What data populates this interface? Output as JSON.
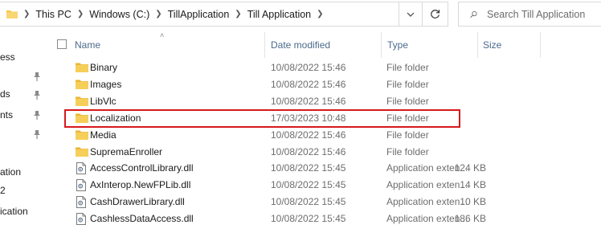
{
  "address_bar": {
    "crumbs": [
      "This PC",
      "Windows (C:)",
      "TillApplication",
      "Till Application"
    ]
  },
  "search": {
    "placeholder": "Search Till Application"
  },
  "nav_pane": {
    "items": [
      "ess",
      "ds",
      "nts",
      "ation",
      "2",
      "ication"
    ]
  },
  "columns": {
    "name": "Name",
    "date_modified": "Date modified",
    "type": "Type",
    "size": "Size"
  },
  "files": [
    {
      "name": "Binary",
      "date": "10/08/2022 15:46",
      "type": "File folder",
      "size": "",
      "kind": "folder"
    },
    {
      "name": "Images",
      "date": "10/08/2022 15:46",
      "type": "File folder",
      "size": "",
      "kind": "folder"
    },
    {
      "name": "LibVlc",
      "date": "10/08/2022 15:46",
      "type": "File folder",
      "size": "",
      "kind": "folder"
    },
    {
      "name": "Localization",
      "date": "17/03/2023 10:48",
      "type": "File folder",
      "size": "",
      "kind": "folder"
    },
    {
      "name": "Media",
      "date": "10/08/2022 15:46",
      "type": "File folder",
      "size": "",
      "kind": "folder"
    },
    {
      "name": "SupremaEnroller",
      "date": "10/08/2022 15:46",
      "type": "File folder",
      "size": "",
      "kind": "folder"
    },
    {
      "name": "AccessControlLibrary.dll",
      "date": "10/08/2022 15:45",
      "type": "Application exten...",
      "size": "124 KB",
      "kind": "dll"
    },
    {
      "name": "AxInterop.NewFPLib.dll",
      "date": "10/08/2022 15:45",
      "type": "Application exten...",
      "size": "14 KB",
      "kind": "dll"
    },
    {
      "name": "CashDrawerLibrary.dll",
      "date": "10/08/2022 15:45",
      "type": "Application exten...",
      "size": "10 KB",
      "kind": "dll"
    },
    {
      "name": "CashlessDataAccess.dll",
      "date": "10/08/2022 15:45",
      "type": "Application exten...",
      "size": "186 KB",
      "kind": "dll"
    }
  ],
  "highlighted_item": "Localization",
  "colors": {
    "folder": "#f4c84b",
    "highlight_border": "#d7191c",
    "header_text": "#4b6a8c"
  }
}
